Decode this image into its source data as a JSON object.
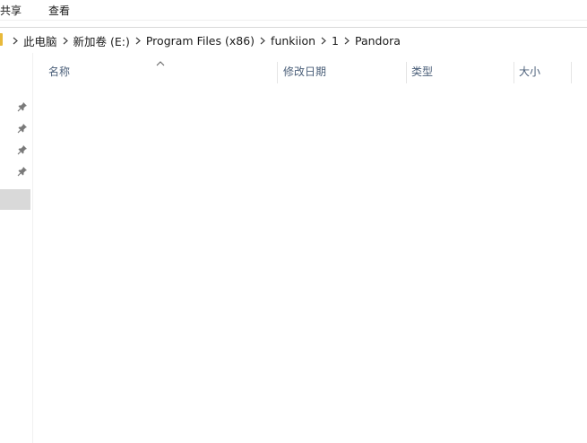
{
  "ribbon": {
    "tabs": [
      {
        "label": "共享"
      },
      {
        "label": "查看"
      }
    ]
  },
  "breadcrumb": {
    "items": [
      {
        "label": "此电脑"
      },
      {
        "label": "新加卷 (E:)"
      },
      {
        "label": "Program Files (x86)"
      },
      {
        "label": "funkiion"
      },
      {
        "label": "1"
      },
      {
        "label": "Pandora"
      }
    ]
  },
  "columns": [
    {
      "label": "名称"
    },
    {
      "label": "修改日期"
    },
    {
      "label": "类型"
    },
    {
      "label": "大小"
    }
  ],
  "icons": {
    "pin": "pin-icon",
    "breadcrumb_separator": "chevron-right-icon",
    "sort": "sort-ascending-icon"
  },
  "colors": {
    "header_text": "#4c607a",
    "selection": "#d9d9d9",
    "folder": "#e8b93a"
  }
}
